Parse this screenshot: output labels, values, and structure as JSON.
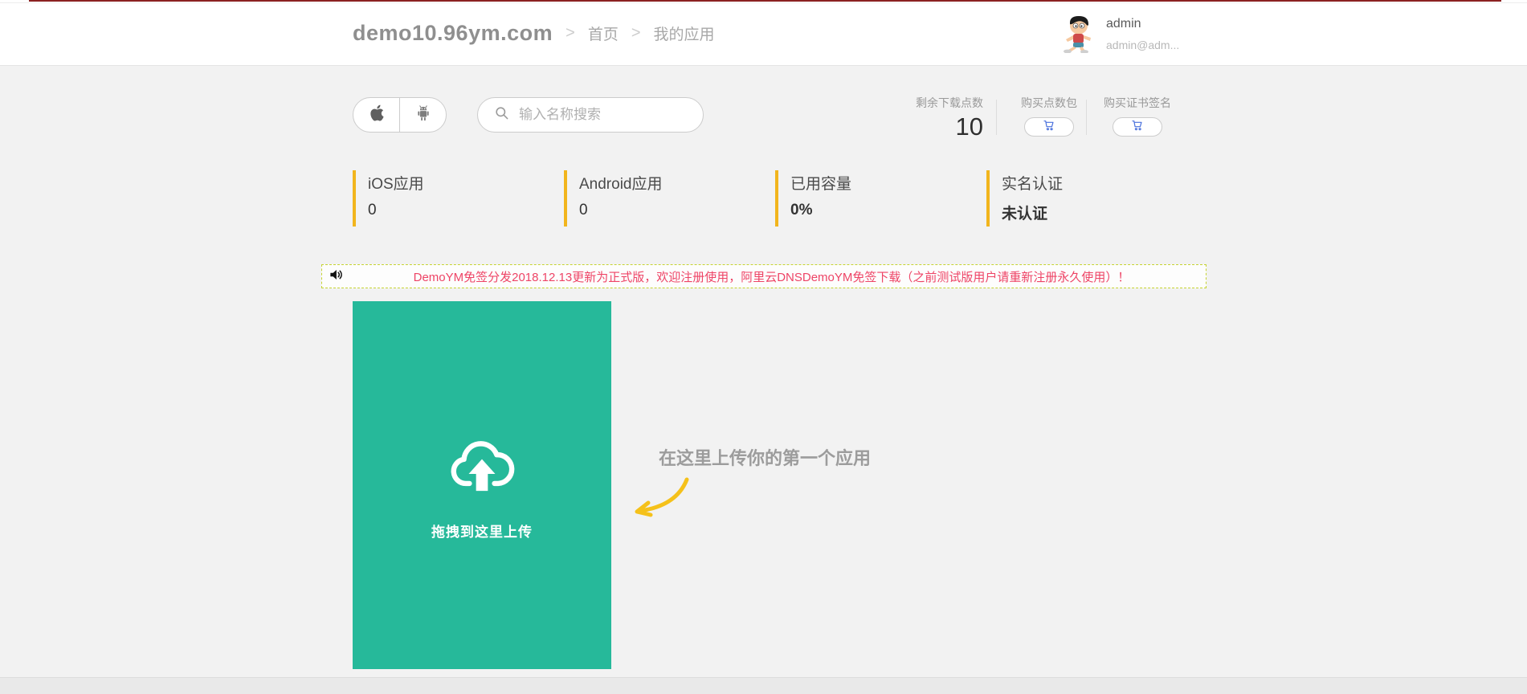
{
  "header": {
    "site_title": "demo10.96ym.com",
    "breadcrumb_separator": ">",
    "breadcrumb": {
      "home": "首页",
      "current": "我的应用"
    },
    "user": {
      "name": "admin",
      "email": "admin@adm..."
    }
  },
  "toolbar": {
    "search_placeholder": "输入名称搜索",
    "remaining_points": {
      "label": "剩余下载点数",
      "value": "10"
    },
    "buy_points": {
      "label": "购买点数包"
    },
    "buy_cert": {
      "label": "购买证书签名"
    }
  },
  "stats": [
    {
      "label": "iOS应用",
      "value": "0"
    },
    {
      "label": "Android应用",
      "value": "0"
    },
    {
      "label": "已用容量",
      "value": "0%"
    },
    {
      "label": "实名认证",
      "value": "未认证"
    }
  ],
  "announcement": {
    "text": "DemoYM免签分发2018.12.13更新为正式版，欢迎注册使用，阿里云DNSDemoYM免签下载（之前测试版用户请重新注册永久使用）！"
  },
  "upload": {
    "dropzone_label": "拖拽到这里上传",
    "hint": "在这里上传你的第一个应用"
  },
  "icons": {
    "apple": "apple-logo",
    "android": "android-robot",
    "search": "magnifier",
    "cart": "shopping-cart",
    "speaker": "announcement-speaker",
    "cloud_upload": "upload-cloud",
    "arrow": "curved-pointer-arrow"
  },
  "colors": {
    "accent_green": "#26b99a",
    "accent_yellow": "#f2b51d",
    "announcement_text": "#ee4466",
    "announcement_border": "#c6d332",
    "cart_blue": "#4a71dd",
    "top_bar_red": "#8b2121",
    "page_background": "#f2f2f2"
  }
}
